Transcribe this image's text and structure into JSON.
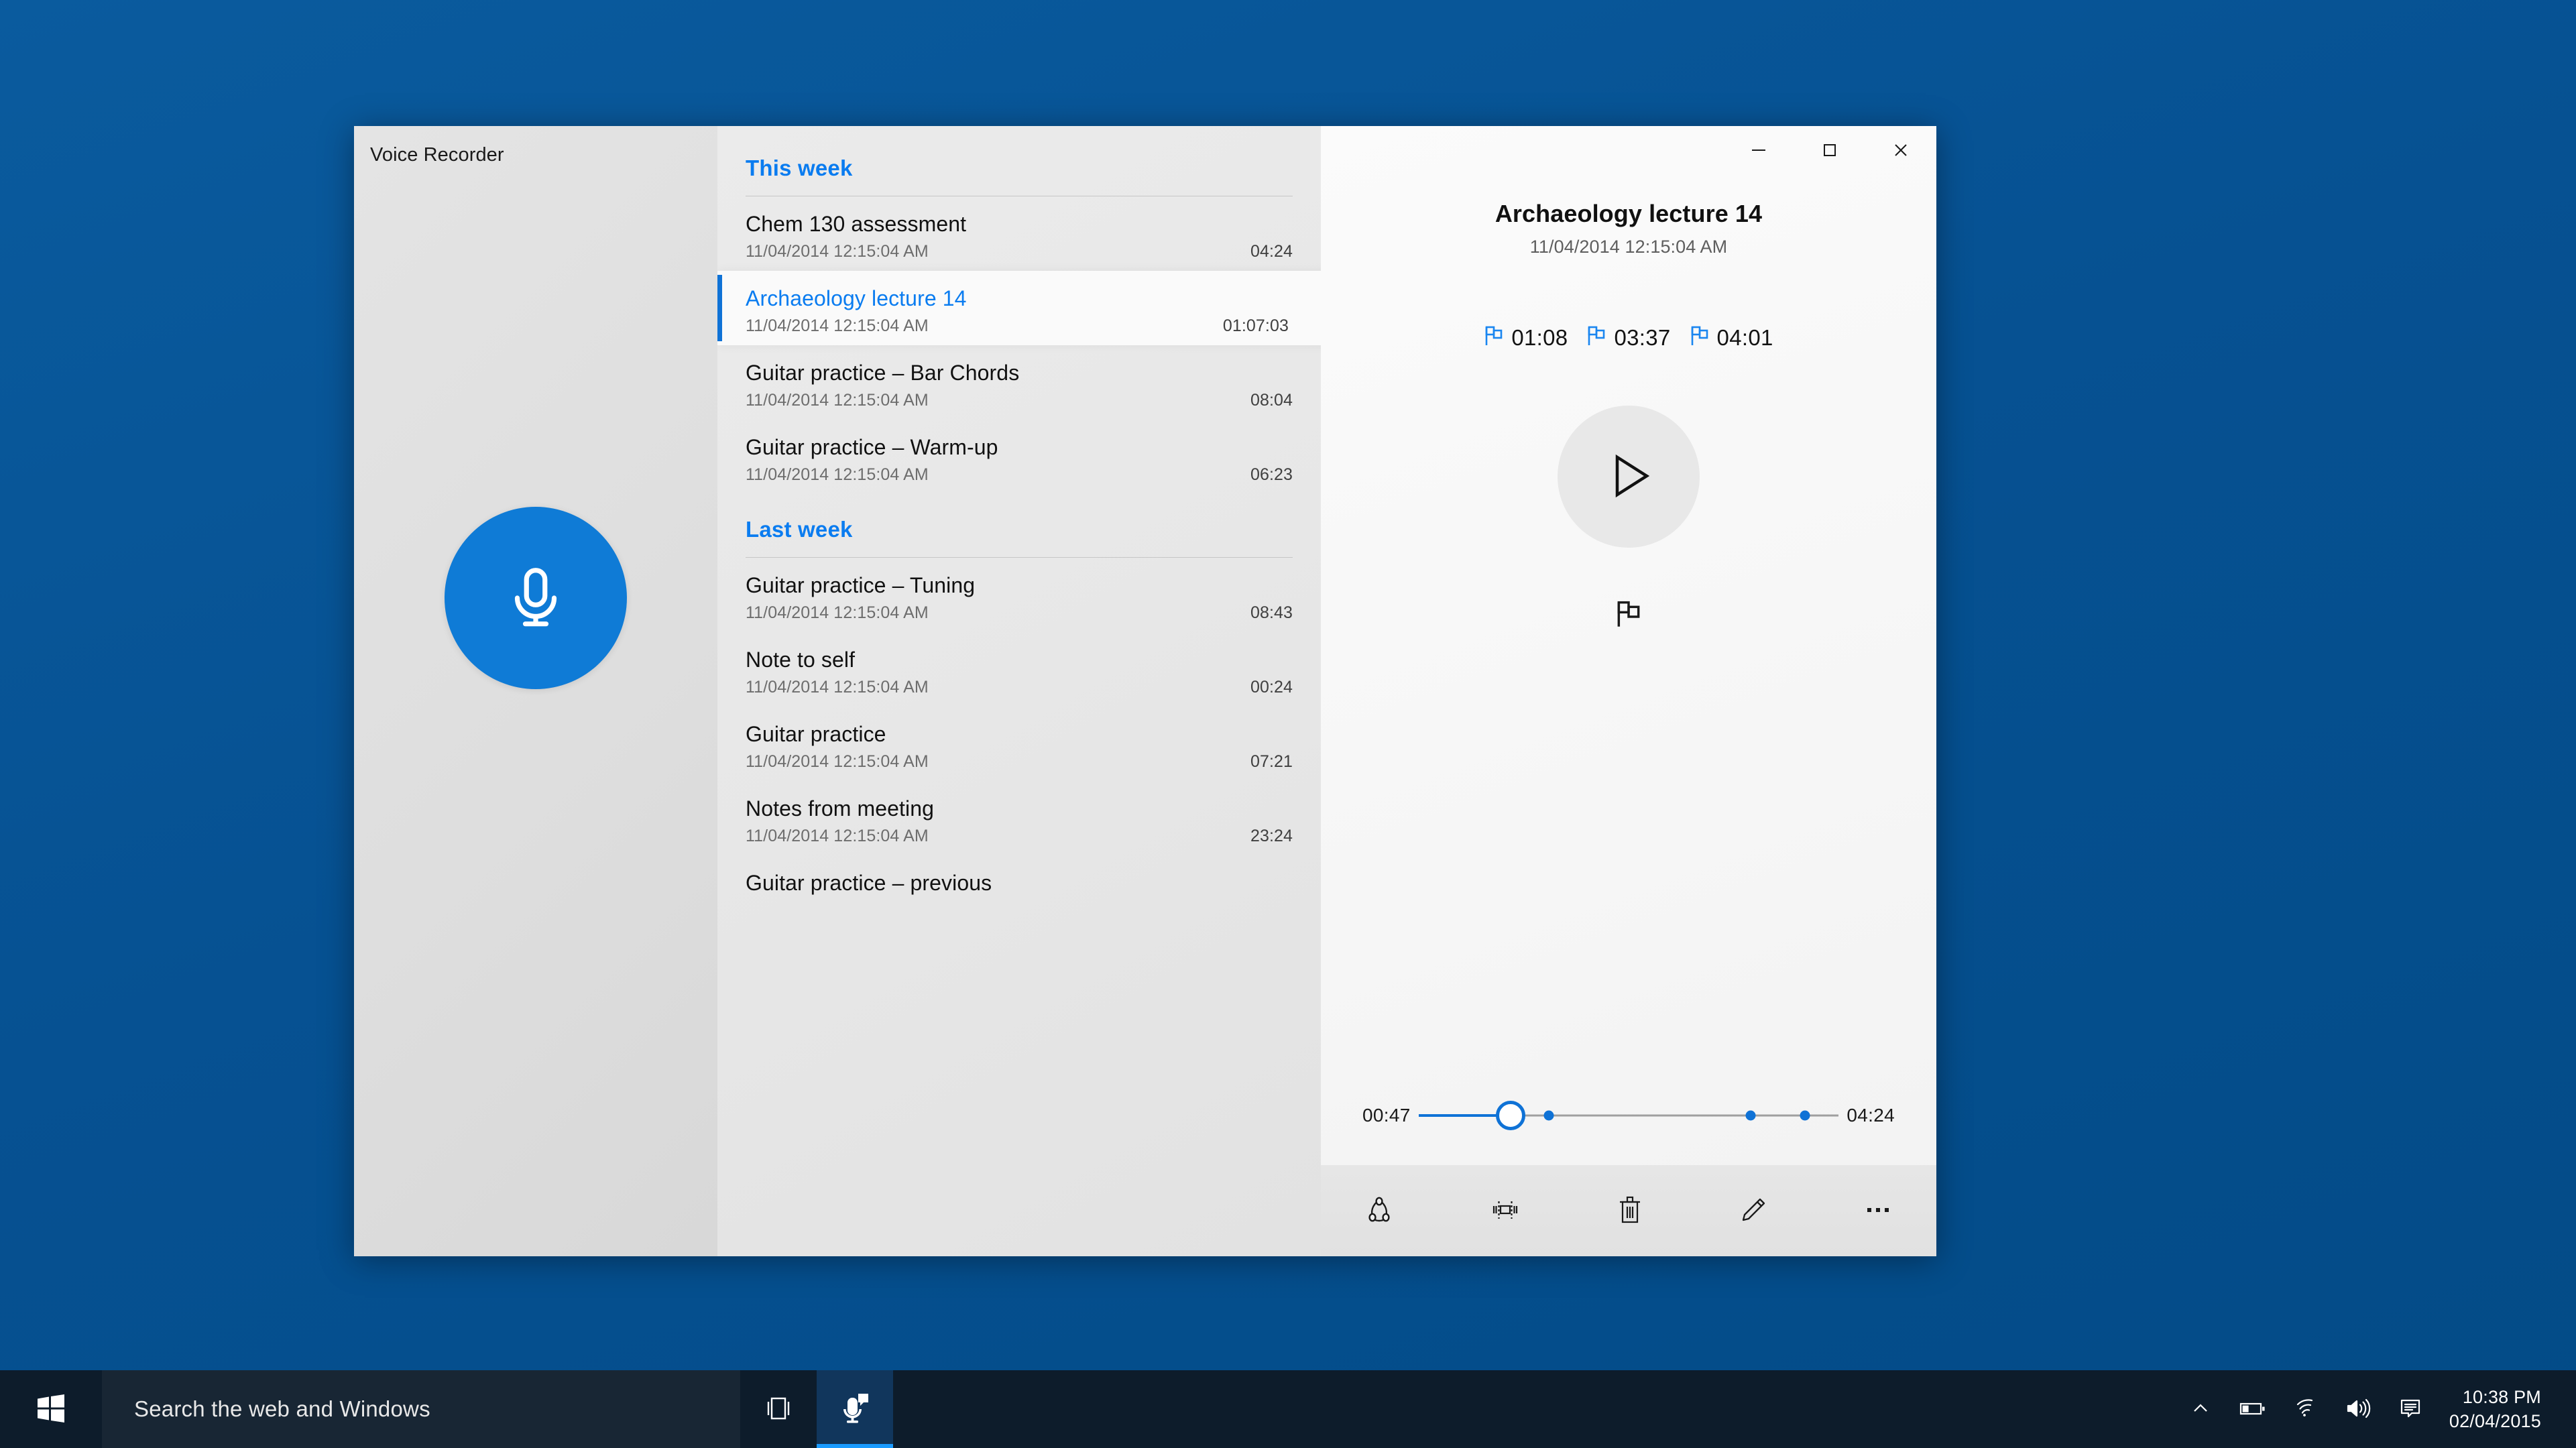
{
  "app": {
    "title": "Voice Recorder",
    "record_button_label": "Record"
  },
  "window_controls": {
    "minimize": "minimize-icon",
    "maximize": "maximize-icon",
    "close": "close-icon"
  },
  "list": {
    "sections": [
      {
        "label": "This week",
        "items": [
          {
            "title": "Chem 130 assessment",
            "date": "11/04/2014 12:15:04 AM",
            "duration": "04:24",
            "selected": false
          },
          {
            "title": "Archaeology lecture 14",
            "date": "11/04/2014 12:15:04 AM",
            "duration": "01:07:03",
            "selected": true
          },
          {
            "title": "Guitar practice – Bar Chords",
            "date": "11/04/2014 12:15:04 AM",
            "duration": "08:04",
            "selected": false
          },
          {
            "title": "Guitar practice – Warm-up",
            "date": "11/04/2014 12:15:04 AM",
            "duration": "06:23",
            "selected": false
          }
        ]
      },
      {
        "label": "Last week",
        "items": [
          {
            "title": "Guitar practice – Tuning",
            "date": "11/04/2014 12:15:04 AM",
            "duration": "08:43",
            "selected": false
          },
          {
            "title": "Note to self",
            "date": "11/04/2014 12:15:04 AM",
            "duration": "00:24",
            "selected": false
          },
          {
            "title": "Guitar practice",
            "date": "11/04/2014 12:15:04 AM",
            "duration": "07:21",
            "selected": false
          },
          {
            "title": "Notes from meeting",
            "date": "11/04/2014 12:15:04 AM",
            "duration": "23:24",
            "selected": false
          },
          {
            "title": "Guitar practice – previous",
            "date": "",
            "duration": "",
            "selected": false
          }
        ]
      }
    ]
  },
  "detail": {
    "title": "Archaeology lecture 14",
    "date": "11/04/2014 12:15:04 AM",
    "flags": [
      "01:08",
      "03:37",
      "04:01"
    ],
    "play_label": "Play",
    "add_flag_label": "Add flag"
  },
  "scrubber": {
    "position": "00:47",
    "duration": "04:24",
    "progress_percent": 22,
    "markers_percent": [
      31,
      79,
      92
    ]
  },
  "command_bar": {
    "buttons": [
      {
        "name": "share-icon",
        "label": "Share"
      },
      {
        "name": "trim-icon",
        "label": "Trim"
      },
      {
        "name": "delete-icon",
        "label": "Delete"
      },
      {
        "name": "rename-icon",
        "label": "Rename"
      },
      {
        "name": "more-icon",
        "label": "See more"
      }
    ]
  },
  "taskbar": {
    "start_label": "Start",
    "search_placeholder": "Search the web and Windows",
    "task_view_label": "Task View",
    "recorder_label": "Voice Recorder",
    "tray": [
      {
        "name": "show-hidden-icons-icon",
        "label": "Show hidden icons"
      },
      {
        "name": "battery-icon",
        "label": "Battery"
      },
      {
        "name": "wifi-icon",
        "label": "Network"
      },
      {
        "name": "volume-icon",
        "label": "Volume"
      },
      {
        "name": "action-center-icon",
        "label": "Action Center"
      }
    ],
    "clock": {
      "time": "10:38 PM",
      "date": "02/04/2015"
    }
  },
  "colors": {
    "accent": "#0f72d6",
    "accent_text": "#0a7cf0",
    "desktop": "#065192",
    "taskbar": "#0d1c2b"
  }
}
